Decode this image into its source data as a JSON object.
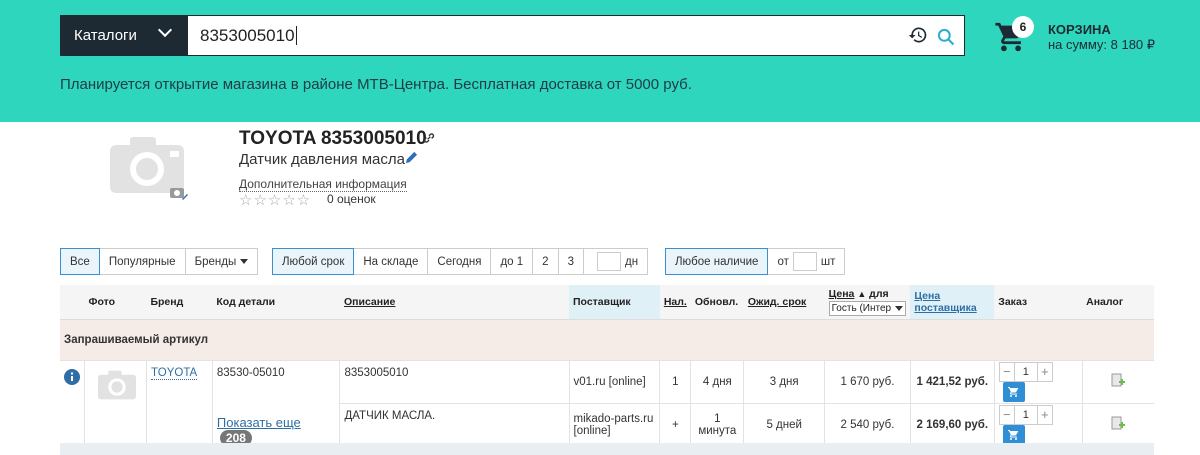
{
  "header": {
    "catalogs_label": "Каталоги",
    "search_value": "8353005010",
    "cart_count": "6",
    "cart_title": "КОРЗИНА",
    "cart_sum": "на сумму: 8 180 ₽",
    "announcement": "Планируется открытие магазина в районе МТВ-Центра. Бесплатная доставка от 5000 руб."
  },
  "product": {
    "title": "TOYOTA 8353005010",
    "subtitle": "Датчик давления масла",
    "additional_info": "Дополнительная информация",
    "stars": "☆☆☆☆☆",
    "rating_text": "0 оценок"
  },
  "filters": {
    "group1": [
      "Все",
      "Популярные",
      "Бренды"
    ],
    "group2": [
      "Любой срок",
      "На складе",
      "Сегодня",
      "до 1",
      "2",
      "3",
      "дн"
    ],
    "group3": [
      "Любое наличие",
      "от",
      "шт"
    ]
  },
  "table": {
    "headers": {
      "photo": "Фото",
      "brand": "Бренд",
      "code": "Код детали",
      "desc": "Описание",
      "supplier": "Поставщик",
      "avail": "Нал.",
      "updated": "Обновл.",
      "expected": "Ожид. срок",
      "price": "Цена",
      "for": "для",
      "price_select": "Гость (Интер",
      "supplier_price": "Цена поставщика",
      "order": "Заказ",
      "analog": "Аналог"
    },
    "requested_label": "Запрашиваемый артикул",
    "brand": "TOYOTA",
    "code": "83530-05010",
    "show_more": "Показать еще",
    "show_more_count": "208",
    "rows": [
      {
        "desc": "8353005010",
        "supplier": "v01.ru [online]",
        "avail": "1",
        "updated": "4 дня",
        "expected": "3 дня",
        "price": "1 670 руб.",
        "supplier_price": "1 421,52 руб.",
        "qty": "1"
      },
      {
        "desc": "ДАТЧИК МАСЛА.",
        "supplier": "mikado-parts.ru [online]",
        "avail": "+",
        "updated": "1 минута",
        "expected": "5 дней",
        "price": "2 540 руб.",
        "supplier_price": "2 169,60 руб.",
        "qty": "1"
      }
    ]
  },
  "colors": {
    "header_bg": "#2ed6bd",
    "dark": "#1e2a33",
    "accent": "#2e8fd6"
  }
}
